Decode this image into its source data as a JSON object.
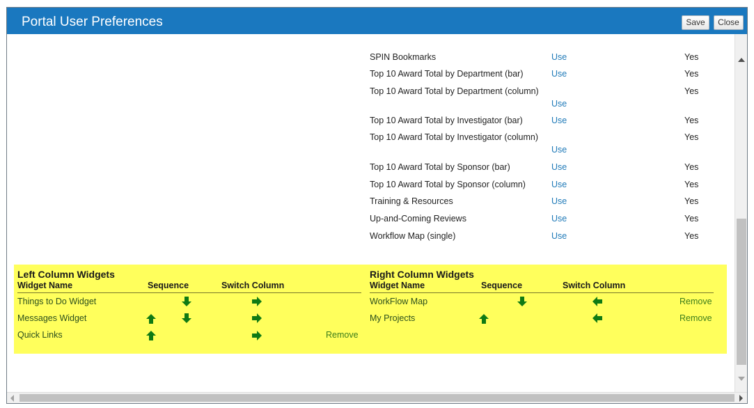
{
  "window": {
    "title": "Portal User Preferences",
    "save_label": "Save",
    "close_label": "Close"
  },
  "widgets_list": [
    {
      "name": "SPIN Bookmarks",
      "action": "Use",
      "visible": "Yes"
    },
    {
      "name": "Top 10 Award Total by Department (bar)",
      "action": "Use",
      "visible": "Yes"
    },
    {
      "name": "Top 10 Award Total by Department (column)",
      "action": "Use",
      "visible": "Yes"
    },
    {
      "name": "Top 10 Award Total by Investigator (bar)",
      "action": "Use",
      "visible": "Yes"
    },
    {
      "name": "Top 10 Award Total by Investigator (column)",
      "action": "Use",
      "visible": "Yes"
    },
    {
      "name": "Top 10 Award Total by Sponsor (bar)",
      "action": "Use",
      "visible": "Yes"
    },
    {
      "name": "Top 10 Award Total by Sponsor (column)",
      "action": "Use",
      "visible": "Yes"
    },
    {
      "name": "Training & Resources",
      "action": "Use",
      "visible": "Yes"
    },
    {
      "name": "Up-and-Coming Reviews",
      "action": "Use",
      "visible": "Yes"
    },
    {
      "name": "Workflow Map (single)",
      "action": "Use",
      "visible": "Yes"
    }
  ],
  "left_column": {
    "heading": "Left Column Widgets",
    "col_widget_name": "Widget Name",
    "col_sequence": "Sequence",
    "col_switch": "Switch Column",
    "rows": [
      {
        "name": "Things to Do Widget",
        "remove": ""
      },
      {
        "name": "Messages Widget",
        "remove": ""
      },
      {
        "name": "Quick Links",
        "remove": "Remove"
      }
    ]
  },
  "right_column": {
    "heading": "Right Column Widgets",
    "col_widget_name": "Widget Name",
    "col_sequence": "Sequence",
    "col_switch": "Switch Column",
    "rows": [
      {
        "name": "WorkFlow Map",
        "remove": "Remove"
      },
      {
        "name": "My Projects",
        "remove": "Remove"
      }
    ]
  },
  "colors": {
    "title_bar": "#1a78bf",
    "highlight": "#ffff5c",
    "arrow": "#0f7a14",
    "link": "#1f7ab8"
  },
  "icons": {
    "up": "arrow-up-icon",
    "down": "arrow-down-icon",
    "right": "arrow-right-icon",
    "left": "arrow-left-icon"
  }
}
